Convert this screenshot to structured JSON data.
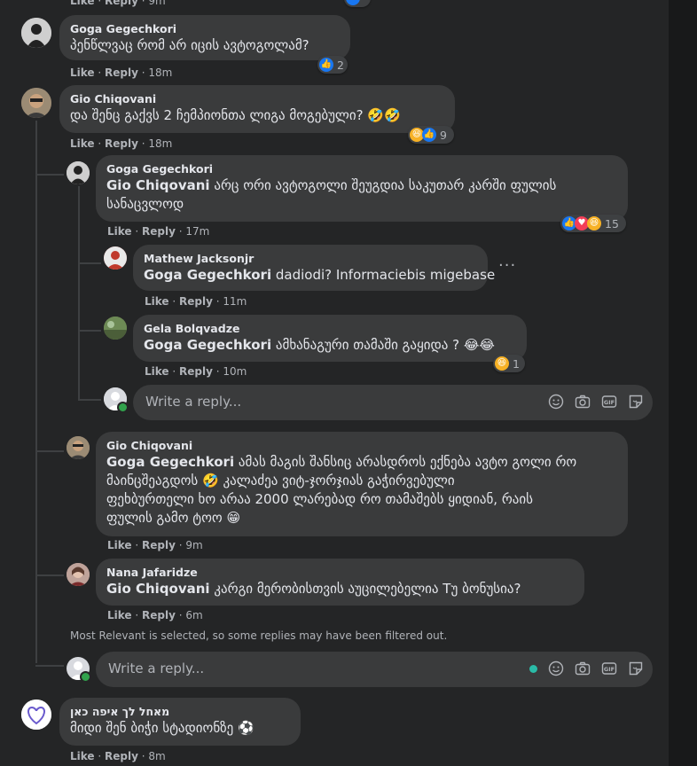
{
  "labels": {
    "like": "Like",
    "reply": "Reply",
    "sep": " · ",
    "dot": "·"
  },
  "top_partial": {
    "time": "9m"
  },
  "comments": [
    {
      "id": "c1",
      "author": "Goga Gegechkori",
      "mention": "",
      "text": "პენწლვაც რომ არ იცის ავტოგოლამ?",
      "time": "18m",
      "reactions": "2"
    },
    {
      "id": "c2",
      "author": "Gio Chiqovani",
      "mention": "",
      "text": "და შენც გაქვს 2 ჩემპიონთა ლიგა მოგებული? 🤣🤣",
      "time": "18m",
      "reactions": "9"
    },
    {
      "id": "c3",
      "author": "Goga Gegechkori",
      "mention": "Gio Chiqovani",
      "text_lines": [
        "არც ორი ავტოგოლი შეუგდია საკუთარ კარში ფულის",
        "სანაცვლოდ"
      ],
      "time": "17m",
      "reactions": "15"
    },
    {
      "id": "c4",
      "author": "Mathew Jacksonjr",
      "mention": "Goga Gegechkori",
      "text": "dadiodi? Informaciebis migebase",
      "time": "11m"
    },
    {
      "id": "c5",
      "author": "Gela Bolqvadze",
      "mention": "Goga Gegechkori",
      "text": "ამხანაგური თამაში გაყიდა ? 😂😂",
      "time": "10m",
      "reactions": "1"
    },
    {
      "id": "c6",
      "author": "Gio Chiqovani",
      "mention": "Goga Gegechkori",
      "text_lines": [
        "ამას მაგის შანსიც არასდროს ექნება ავტო გოლი რო",
        "მაინცშეაგდოს 🤣 კალაძეა ვიტ-ჯორჯიას გაჭირვებული",
        "ფეხბურთელი ხო არაა 2000 ლარებად რო თამაშებს ყიდიან, რაის",
        "ფულის გამო ტოო 😁"
      ],
      "time": "9m"
    },
    {
      "id": "c7",
      "author": "Nana Jafaridze",
      "mention": "Gio Chiqovani",
      "text": "კარგი მერობისთვის აუცილებელია Tუ ბონუსია?",
      "time": "6m"
    },
    {
      "id": "c8",
      "author": "מאחל לך איפה כאן",
      "mention": "",
      "text": "მიდი შენ ბიჭი სტადიონზე ⚽",
      "time": "8m"
    }
  ],
  "reply_placeholder": "Write a reply...",
  "filter_note": "Most Relevant is selected, so some replies may have been filtered out.",
  "colors": {
    "bg": "#242526",
    "bubble": "#3a3b3c",
    "text": "#e4e6eb",
    "muted": "#b0b3b8",
    "like": "#1877f2",
    "love": "#f33e58",
    "online": "#31a24c"
  }
}
